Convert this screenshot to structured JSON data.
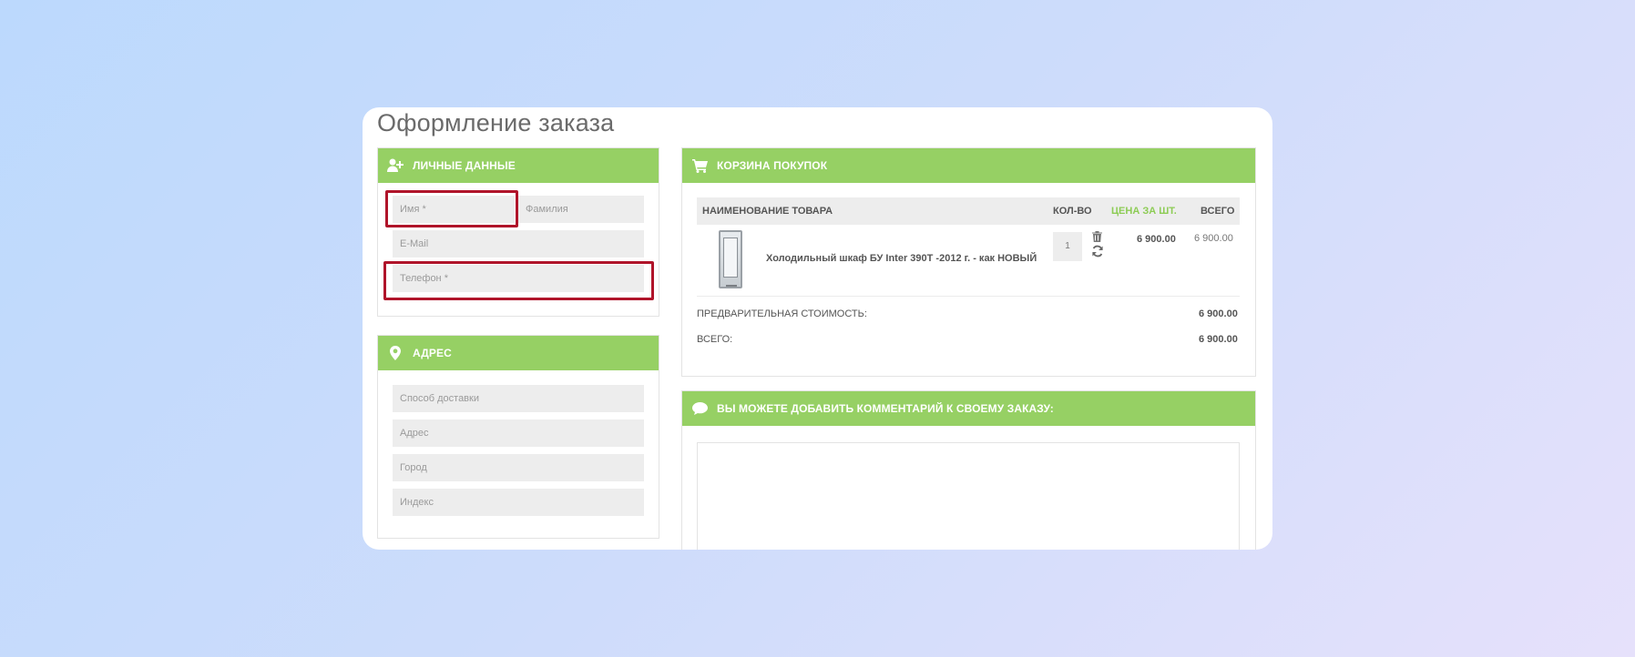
{
  "page": {
    "title": "Оформление заказа"
  },
  "personal": {
    "header": "ЛИЧНЫЕ ДАННЫЕ",
    "first_name_placeholder": "Имя *",
    "last_name_placeholder": "Фамилия",
    "email_placeholder": "E-Mail",
    "phone_placeholder": "Телефон *"
  },
  "address": {
    "header": "АДРЕС",
    "delivery_placeholder": "Способ доставки",
    "address_placeholder": "Адрес",
    "city_placeholder": "Город",
    "index_placeholder": "Индекс"
  },
  "cart": {
    "header": "КОРЗИНА ПОКУПОК",
    "columns": {
      "name": "НАИМЕНОВАНИЕ ТОВАРА",
      "qty": "КОЛ-ВО",
      "price": "ЦЕНА ЗА ШТ.",
      "total": "ВСЕГО"
    },
    "items": [
      {
        "name": "Холодильный шкаф БУ Inter 390Т -2012 г. - как НОВЫЙ",
        "qty": "1",
        "price": "6 900.00",
        "total": "6 900.00"
      }
    ],
    "subtotal_label": "ПРЕДВАРИТЕЛЬНАЯ СТОИМОСТЬ:",
    "subtotal_value": "6 900.00",
    "grand_label": "ВСЕГО:",
    "grand_value": "6 900.00"
  },
  "comment": {
    "header": "ВЫ МОЖЕТЕ ДОБАВИТЬ КОММЕНТАРИЙ К СВОЕМУ ЗАКАЗУ:"
  },
  "colors": {
    "accent": "#96d064",
    "highlight": "#b0142a"
  },
  "icons": {
    "personal": "user-plus-icon",
    "address": "map-marker-icon",
    "cart": "shopping-cart-icon",
    "comment": "comment-icon",
    "delete": "trash-icon",
    "refresh": "refresh-icon"
  }
}
